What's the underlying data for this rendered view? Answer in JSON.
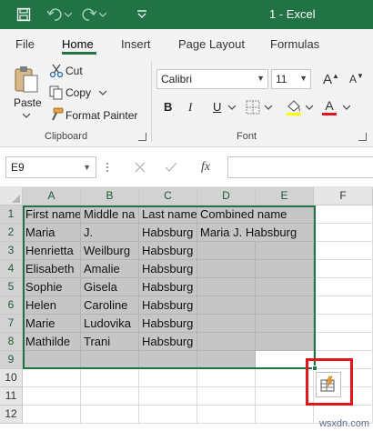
{
  "titlebar": {
    "title": "1  -  Excel",
    "colors": {
      "background": "#217346",
      "text": "#ffffff"
    },
    "icons": [
      "save-icon",
      "undo-icon",
      "redo-icon",
      "customize-qat-icon"
    ]
  },
  "tabs": [
    {
      "label": "File",
      "active": false
    },
    {
      "label": "Home",
      "active": true
    },
    {
      "label": "Insert",
      "active": false
    },
    {
      "label": "Page Layout",
      "active": false
    },
    {
      "label": "Formulas",
      "active": false
    }
  ],
  "ribbon": {
    "clipboard": {
      "paste": "Paste",
      "cut": "Cut",
      "copy": "Copy",
      "format_painter": "Format Painter",
      "label": "Clipboard"
    },
    "font": {
      "name": "Calibri",
      "size": "11",
      "label": "Font",
      "bold": "B",
      "italic": "I",
      "underline": "U",
      "font_color_glyph": "A",
      "fill_color": "#ffff00",
      "font_color": "#e3141b"
    }
  },
  "formula_bar": {
    "name_box": "E9",
    "fx": "fx",
    "formula": ""
  },
  "sheet": {
    "columns": [
      "A",
      "B",
      "C",
      "D",
      "E",
      "F"
    ],
    "selected_columns": [
      "A",
      "B",
      "C",
      "D",
      "E"
    ],
    "rows": [
      "1",
      "2",
      "3",
      "4",
      "5",
      "6",
      "7",
      "8",
      "9",
      "10",
      "11",
      "12"
    ],
    "selected_rows": [
      "1",
      "2",
      "3",
      "4",
      "5",
      "6",
      "7",
      "8",
      "9"
    ],
    "cells": {
      "A1": "First name",
      "B1": "Middle na",
      "C1": "Last name",
      "D1": "Combined name",
      "A2": "Maria",
      "B2": "J.",
      "C2": "Habsburg",
      "D2": "Maria  J. Habsburg",
      "A3": "Henrietta",
      "B3": "Weilburg",
      "C3": "Habsburg",
      "A4": "Elisabeth",
      "B4": "Amalie",
      "C4": "Habsburg",
      "A5": "Sophie",
      "B5": "Gisela",
      "C5": "Habsburg",
      "A6": "Helen",
      "B6": "Caroline",
      "C6": "Habsburg",
      "A7": "Marie",
      "B7": "Ludovika",
      "C7": "Habsburg",
      "A8": "Mathilde",
      "B8": "Trani",
      "C8": "Habsburg"
    },
    "active_cell": "E9",
    "selection": "A1:E9",
    "selection_color": "#217346",
    "quick_analysis_icon": "quick-analysis-icon",
    "highlight_color": "#e3141b"
  },
  "watermark": "wsxdn.com"
}
